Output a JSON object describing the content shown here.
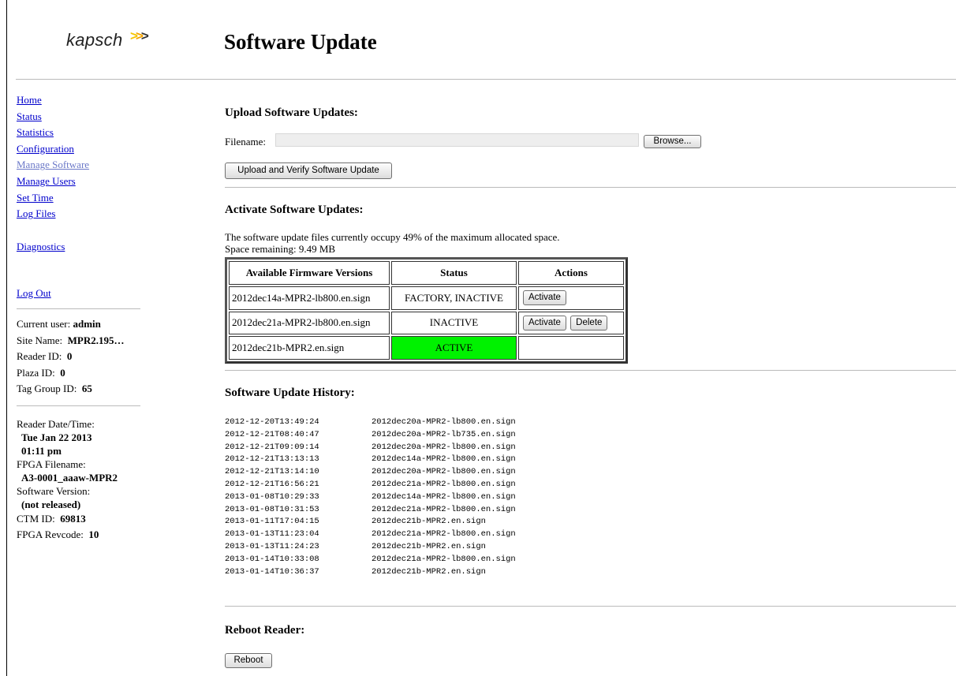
{
  "header": {
    "logo_text": "kapsch",
    "logo_chevrons": ">>>",
    "page_title": "Software Update"
  },
  "colors": {
    "link": "#0000cc",
    "visited_link": "#6b78c8",
    "active_status": "#00f200",
    "logo_chevron": "#f5a400"
  },
  "sidebar": {
    "nav": [
      {
        "label": "Home"
      },
      {
        "label": "Status"
      },
      {
        "label": "Statistics"
      },
      {
        "label": "Configuration"
      },
      {
        "label": "Manage Software",
        "current": true
      },
      {
        "label": "Manage Users"
      },
      {
        "label": "Set Time"
      },
      {
        "label": "Log Files"
      }
    ],
    "diagnostics": "Diagnostics",
    "logout": "Log Out",
    "info": {
      "current_user_label": "Current user:",
      "current_user": "admin",
      "site_name_label": "Site Name:",
      "site_name": "MPR2.195…",
      "reader_id_label": "Reader ID:",
      "reader_id": "0",
      "plaza_id_label": "Plaza ID:",
      "plaza_id": "0",
      "tag_group_id_label": "Tag Group ID:",
      "tag_group_id": "65"
    },
    "details": {
      "reader_datetime_label": "Reader Date/Time:",
      "reader_date": "Tue Jan 22 2013",
      "reader_time": "01:11 pm",
      "fpga_filename_label": "FPGA Filename:",
      "fpga_filename": "A3-0001_aaaw-MPR2",
      "software_version_label": "Software Version:",
      "software_version": "(not released)",
      "ctm_id_label": "CTM ID:",
      "ctm_id": "69813",
      "fpga_revcode_label": "FPGA Revcode:",
      "fpga_revcode": "10"
    }
  },
  "upload": {
    "title": "Upload Software Updates:",
    "filename_label": "Filename:",
    "filename_value": "",
    "browse_label": "Browse...",
    "upload_button": "Upload and Verify Software Update"
  },
  "activate": {
    "title": "Activate Software Updates:",
    "usage_text": "The software update files currently occupy 49% of the maximum allocated space.",
    "space_text": "Space remaining: 9.49 MB",
    "columns": [
      "Available Firmware Versions",
      "Status",
      "Actions"
    ],
    "rows": [
      {
        "version": "2012dec14a-MPR2-lb800.en.sign",
        "status": "FACTORY, INACTIVE",
        "activate": "Activate",
        "delete": ""
      },
      {
        "version": "2012dec21a-MPR2-lb800.en.sign",
        "status": "INACTIVE",
        "activate": "Activate",
        "delete": "Delete"
      },
      {
        "version": "2012dec21b-MPR2.en.sign",
        "status": "ACTIVE",
        "activate": "",
        "delete": ""
      }
    ]
  },
  "history": {
    "title": "Software Update History:",
    "entries": [
      {
        "ts": "2012-12-20T13:49:24",
        "file": "2012dec20a-MPR2-lb800.en.sign"
      },
      {
        "ts": "2012-12-21T08:40:47",
        "file": "2012dec20a-MPR2-lb735.en.sign"
      },
      {
        "ts": "2012-12-21T09:09:14",
        "file": "2012dec20a-MPR2-lb800.en.sign"
      },
      {
        "ts": "2012-12-21T13:13:13",
        "file": "2012dec14a-MPR2-lb800.en.sign"
      },
      {
        "ts": "2012-12-21T13:14:10",
        "file": "2012dec20a-MPR2-lb800.en.sign"
      },
      {
        "ts": "2012-12-21T16:56:21",
        "file": "2012dec21a-MPR2-lb800.en.sign"
      },
      {
        "ts": "2013-01-08T10:29:33",
        "file": "2012dec14a-MPR2-lb800.en.sign"
      },
      {
        "ts": "2013-01-08T10:31:53",
        "file": "2012dec21a-MPR2-lb800.en.sign"
      },
      {
        "ts": "2013-01-11T17:04:15",
        "file": "2012dec21b-MPR2.en.sign"
      },
      {
        "ts": "2013-01-13T11:23:04",
        "file": "2012dec21a-MPR2-lb800.en.sign"
      },
      {
        "ts": "2013-01-13T11:24:23",
        "file": "2012dec21b-MPR2.en.sign"
      },
      {
        "ts": "2013-01-14T10:33:08",
        "file": "2012dec21a-MPR2-lb800.en.sign"
      },
      {
        "ts": "2013-01-14T10:36:37",
        "file": "2012dec21b-MPR2.en.sign"
      }
    ]
  },
  "reboot": {
    "title": "Reboot Reader:",
    "button": "Reboot"
  }
}
